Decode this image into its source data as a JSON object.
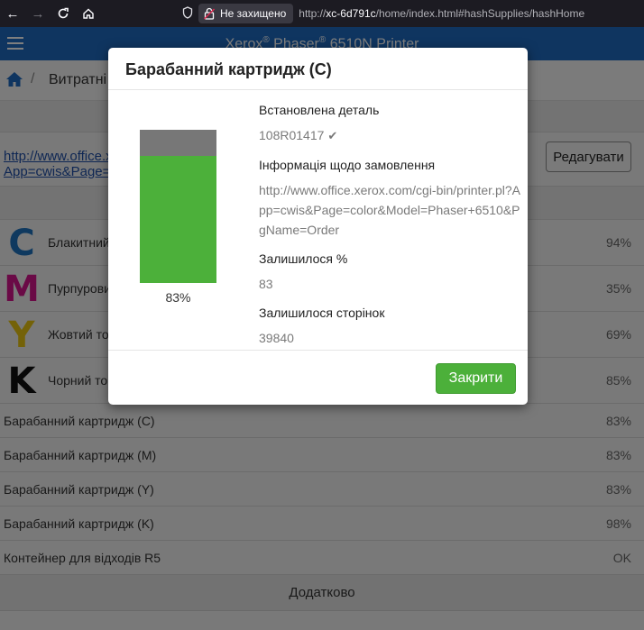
{
  "browser": {
    "security_label": "Не захищено",
    "url_prefix": "http://",
    "url_host": "xc-6d791c",
    "url_path": "/home/index.html#hashSupplies/hashHome"
  },
  "header": {
    "title_xerox": "Xerox",
    "title_reg1": "®",
    "title_phaser": " Phaser",
    "title_reg2": "®",
    "title_model": " 6510N Printer"
  },
  "breadcrumb": {
    "separator": "/",
    "label": "Витратні матеріали"
  },
  "order_url_link": "http://www.office.xerox.com/cgi-bin/printer.pl?App=cwis&Page=color&Model=Phaser+6510&PgName=Order",
  "edit_button": "Редагувати",
  "toners": [
    {
      "letter": "C",
      "name": "Блакитний тонер",
      "percent": "94%",
      "color": "#1e73be"
    },
    {
      "letter": "M",
      "name": "Пурпуровий тонер",
      "percent": "35%",
      "color": "#d4148c"
    },
    {
      "letter": "Y",
      "name": "Жовтий тонер",
      "percent": "69%",
      "color": "#e9c511"
    },
    {
      "letter": "K",
      "name": "Чорний тонер",
      "percent": "85%",
      "color": "#111111"
    }
  ],
  "drums": [
    {
      "name": "Барабанний картридж (C)",
      "percent": "83%"
    },
    {
      "name": "Барабанний картридж (M)",
      "percent": "83%"
    },
    {
      "name": "Барабанний картридж (Y)",
      "percent": "83%"
    },
    {
      "name": "Барабанний картридж (K)",
      "percent": "98%"
    },
    {
      "name": "Контейнер для відходів R5",
      "percent": "OK"
    }
  ],
  "extra_label": "Додатково",
  "modal": {
    "title": "Барабанний картридж (C)",
    "gauge_level": 0.83,
    "gauge_label": "83%",
    "installed_label": "Встановлена деталь",
    "installed_value": "108R01417",
    "order_label": "Інформація щодо замовлення",
    "order_value": "http://www.office.xerox.com/cgi-bin/printer.pl?App=cwis&Page=color&Model=Phaser+6510&PgName=Order",
    "remaining_pct_label": "Залишилося %",
    "remaining_pct_value": "83",
    "remaining_pages_label": "Залишилося сторінок",
    "remaining_pages_value": "39840",
    "close_button": "Закрити"
  },
  "colors": {
    "header_blue": "#1f6ac1",
    "gauge_green": "#4cb03a",
    "gauge_gray": "#777777"
  }
}
